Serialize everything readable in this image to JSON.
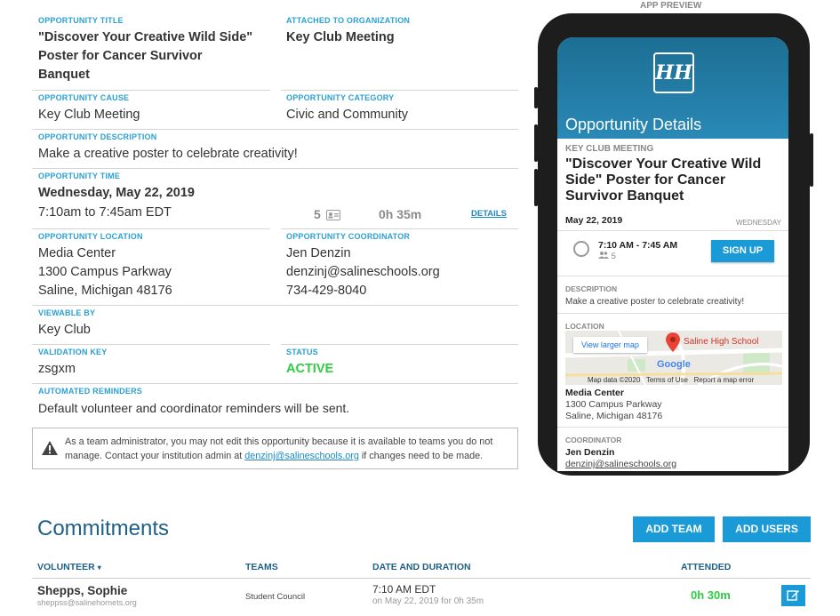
{
  "details": {
    "title_label": "OPPORTUNITY TITLE",
    "title_lines": [
      "\"Discover Your Creative Wild Side\"",
      "Poster for Cancer Survivor",
      "Banquet"
    ],
    "org_label": "ATTACHED TO ORGANIZATION",
    "org_value": "Key Club Meeting",
    "cause_label": "OPPORTUNITY CAUSE",
    "cause_value": "Key Club Meeting",
    "category_label": "OPPORTUNITY CATEGORY",
    "category_value": "Civic and Community",
    "description_label": "OPPORTUNITY DESCRIPTION",
    "description_value": "Make a creative poster to celebrate creativity!",
    "time_label": "OPPORTUNITY TIME",
    "time_date": "Wednesday, May 22, 2019",
    "time_range": "7:10am to 7:45am EDT",
    "slots_count": "5",
    "duration": "0h 35m",
    "details_link": "DETAILS",
    "location_label": "OPPORTUNITY LOCATION",
    "location_lines": [
      "Media Center",
      "1300 Campus Parkway",
      "Saline, Michigan 48176"
    ],
    "coordinator_label": "OPPORTUNITY COORDINATOR",
    "coordinator_lines": [
      "Jen Denzin",
      "denzinj@salineschools.org",
      "734-429-8040"
    ],
    "viewable_label": "VIEWABLE BY",
    "viewable_value": "Key Club",
    "validation_label": "VALIDATION KEY",
    "validation_value": "zsgxm",
    "status_label": "STATUS",
    "status_value": "ACTIVE",
    "reminders_label": "AUTOMATED REMINDERS",
    "reminders_value": "Default volunteer and coordinator reminders will be sent.",
    "notice_pre": "As a team administrator, you may not edit this opportunity because it is available to teams you do not manage. Contact your institution admin at ",
    "notice_email": "denzinj@salineschools.org",
    "notice_post": " if changes need to be made."
  },
  "preview": {
    "header_label": "APP PREVIEW",
    "logo_text": "HH",
    "screen_title": "Opportunity Details",
    "org": "KEY CLUB MEETING",
    "title": "\"Discover Your Creative Wild Side\" Poster for Cancer Survivor Banquet",
    "date": "May 22, 2019",
    "weekday": "WEDNESDAY",
    "time": "7:10 AM - 7:45 AM",
    "slots": "5",
    "signup": "SIGN UP",
    "description_label": "DESCRIPTION",
    "description": "Make a creative poster to celebrate creativity!",
    "location_label": "LOCATION",
    "map_button": "View larger map",
    "map_pin_label": "Saline High School",
    "map_brand": "Google",
    "map_data": "Map data ©2020",
    "map_terms": "Terms of Use",
    "map_report": "Report a map error",
    "location_name": "Media Center",
    "location_addr1": "1300 Campus Parkway",
    "location_addr2": "Saline, Michigan 48176",
    "coordinator_label": "COORDINATOR",
    "coordinator_name": "Jen Denzin",
    "coordinator_email": "denzinj@salineschools.org"
  },
  "commitments": {
    "heading": "Commitments",
    "add_team": "ADD TEAM",
    "add_users": "ADD USERS",
    "columns": {
      "volunteer": "VOLUNTEER",
      "teams": "TEAMS",
      "date": "DATE AND DURATION",
      "attended": "ATTENDED"
    },
    "rows": [
      {
        "name": "Shepps, Sophie",
        "email": "sheppss@salinehornets.org",
        "team": "Student Council",
        "time": "7:10 AM EDT",
        "date_line": "on May 22, 2019 for 0h 35m",
        "attended": "0h 30m"
      }
    ]
  },
  "colors": {
    "accent": "#2aa0d4",
    "button": "#1a9ad6",
    "active": "#2ecc40",
    "phone": "#1d1d1d"
  }
}
